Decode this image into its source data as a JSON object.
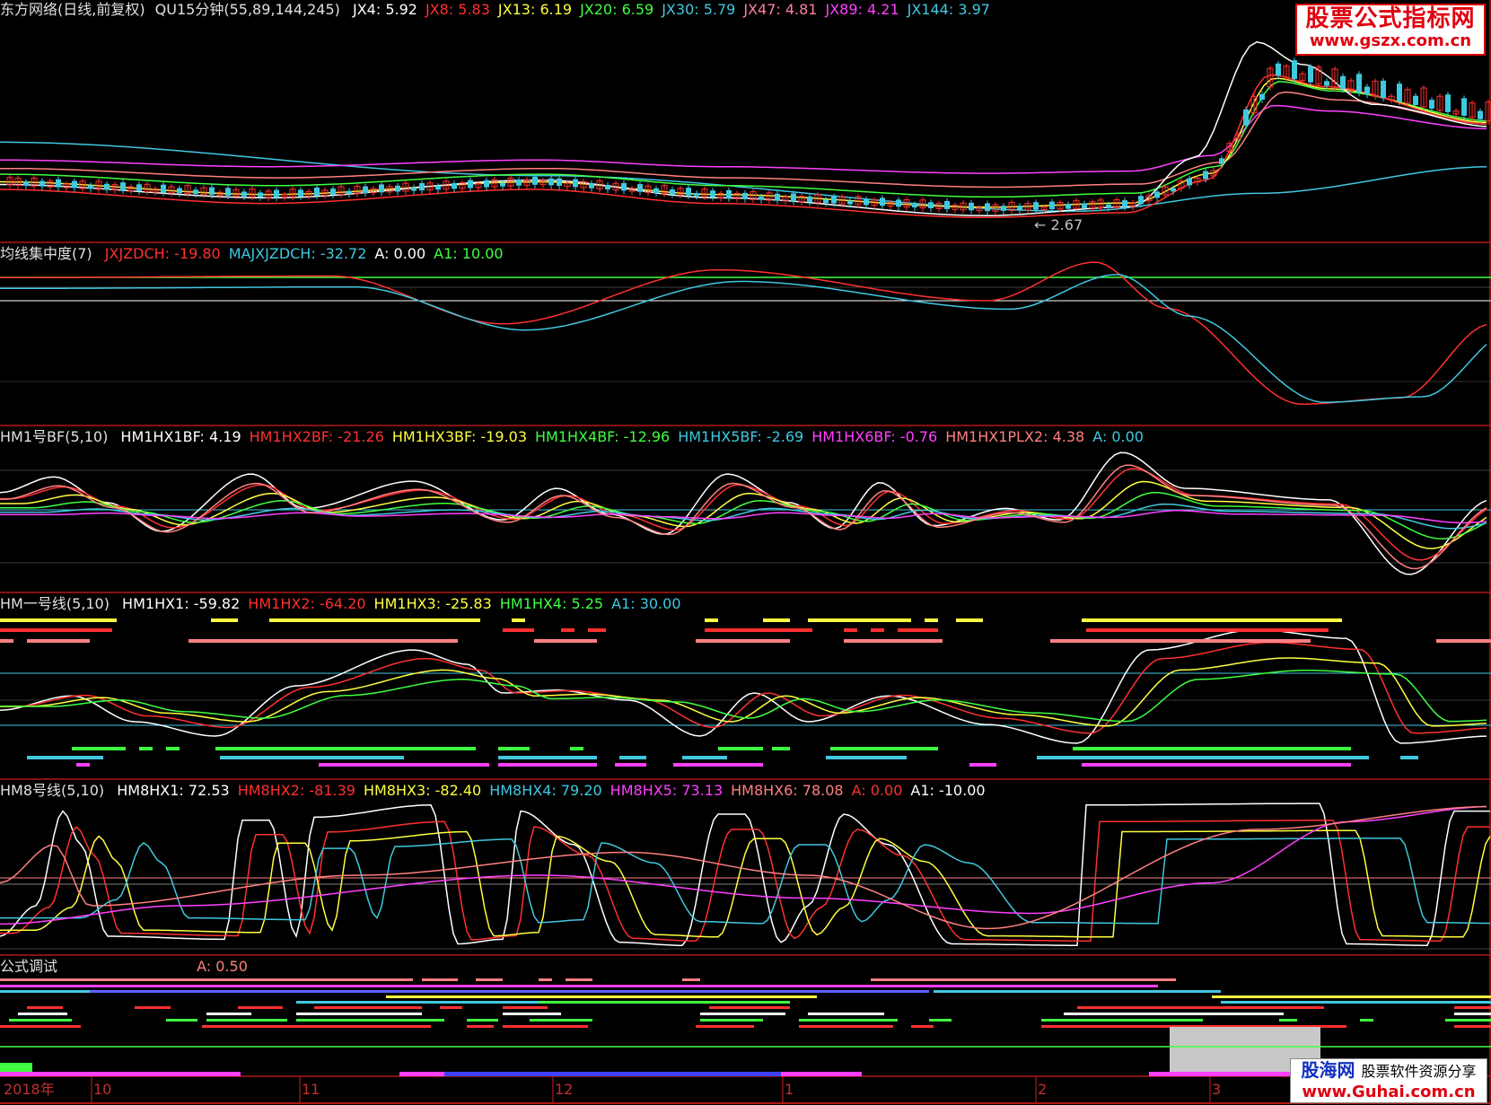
{
  "panel1": {
    "title": "东方网络(日线,前复权)",
    "indicator": "QU15分钟(55,89,144,245)",
    "values": [
      {
        "label": "JX4: 5.92",
        "color": "#ffffff"
      },
      {
        "label": "JX8: 5.83",
        "color": "#ff3030"
      },
      {
        "label": "JX13: 6.19",
        "color": "#ffff40"
      },
      {
        "label": "JX20: 6.59",
        "color": "#40ff40"
      },
      {
        "label": "JX30: 5.79",
        "color": "#40c8e0"
      },
      {
        "label": "JX47: 4.81",
        "color": "#ff80a0"
      },
      {
        "label": "JX89: 4.21",
        "color": "#ff40ff"
      },
      {
        "label": "JX144: 3.97",
        "color": "#40c8e0"
      }
    ],
    "low_marker": "← 2.67"
  },
  "panel2": {
    "title": "均线集中度(7)",
    "values": [
      {
        "label": "JXJZDCH: -19.80",
        "color": "#ff3030"
      },
      {
        "label": "MAJXJZDCH: -32.72",
        "color": "#40c8e0"
      },
      {
        "label": "A: 0.00",
        "color": "#ffffff"
      },
      {
        "label": "A1: 10.00",
        "color": "#40ff40"
      }
    ]
  },
  "panel3": {
    "title": "HM1号BF(5,10)",
    "values": [
      {
        "label": "HM1HX1BF: 4.19",
        "color": "#ffffff"
      },
      {
        "label": "HM1HX2BF: -21.26",
        "color": "#ff3030"
      },
      {
        "label": "HM1HX3BF: -19.03",
        "color": "#ffff40"
      },
      {
        "label": "HM1HX4BF: -12.96",
        "color": "#40ff40"
      },
      {
        "label": "HM1HX5BF: -2.69",
        "color": "#40c8e0"
      },
      {
        "label": "HM1HX6BF: -0.76",
        "color": "#ff40ff"
      },
      {
        "label": "HM1HX1PLX2: 4.38",
        "color": "#ff8080"
      },
      {
        "label": "A: 0.00",
        "color": "#40c8e0"
      }
    ]
  },
  "panel4": {
    "title": "HM一号线(5,10)",
    "values": [
      {
        "label": "HM1HX1: -59.82",
        "color": "#ffffff"
      },
      {
        "label": "HM1HX2: -64.20",
        "color": "#ff3030"
      },
      {
        "label": "HM1HX3: -25.83",
        "color": "#ffff40"
      },
      {
        "label": "HM1HX4: 5.25",
        "color": "#40ff40"
      },
      {
        "label": "A1: 30.00",
        "color": "#40c8e0"
      }
    ]
  },
  "panel5": {
    "title": "HM8号线(5,10)",
    "values": [
      {
        "label": "HM8HX1: 72.53",
        "color": "#ffffff"
      },
      {
        "label": "HM8HX2: -81.39",
        "color": "#ff3030"
      },
      {
        "label": "HM8HX3: -82.40",
        "color": "#ffff40"
      },
      {
        "label": "HM8HX4: 79.20",
        "color": "#40c8e0"
      },
      {
        "label": "HM8HX5: 73.13",
        "color": "#ff40ff"
      },
      {
        "label": "HM8HX6: 78.08",
        "color": "#ff8080"
      },
      {
        "label": "A: 0.00",
        "color": "#ff3030"
      },
      {
        "label": "A1: -10.00",
        "color": "#ffffff"
      }
    ]
  },
  "panel6": {
    "title": "公式调试",
    "values": [
      {
        "label": "A: 0.50",
        "color": "#ff8080"
      }
    ]
  },
  "xaxis": {
    "labels": [
      "2018年",
      "10",
      "11",
      "12",
      "1",
      "2",
      "3"
    ]
  },
  "watermark_top": {
    "line1": "股票公式指标网",
    "line2": "www.gszx.com.cn"
  },
  "watermark_bottom": {
    "brand": "股海网",
    "slogan": "股票软件资源分享",
    "url": "www.Guhai.com.cn"
  },
  "colors": {
    "frame": "#b01818",
    "white": "#ffffff",
    "red": "#ff3030",
    "yellow": "#ffff40",
    "green": "#40ff40",
    "cyan": "#40c8e0",
    "pink": "#ff8080",
    "magenta": "#ff40ff"
  }
}
